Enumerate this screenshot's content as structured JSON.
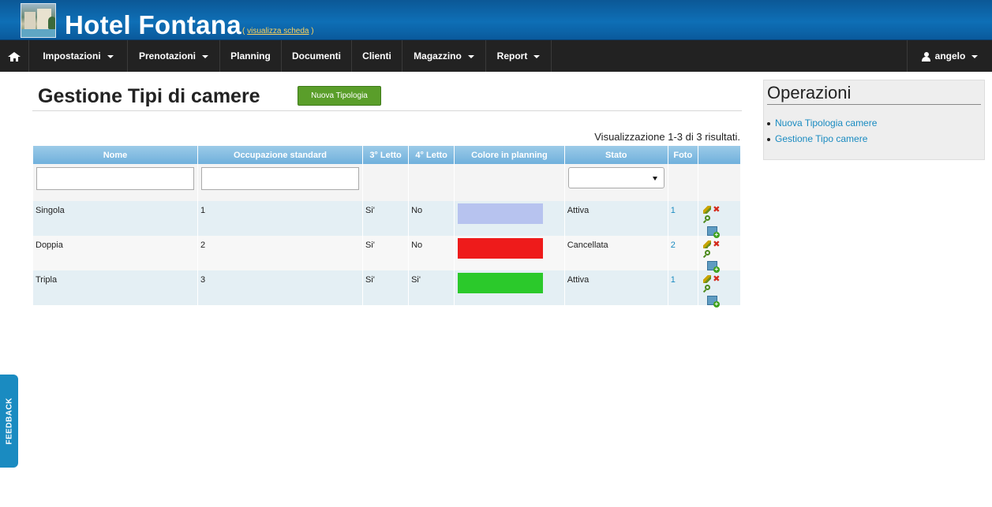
{
  "header": {
    "title": "Hotel Fontana",
    "link_open": "( ",
    "link_text": "visualizza scheda",
    "link_close": " )"
  },
  "nav": {
    "items": [
      {
        "label": "Impostazioni",
        "dropdown": true
      },
      {
        "label": "Prenotazioni",
        "dropdown": true
      },
      {
        "label": "Planning",
        "dropdown": false
      },
      {
        "label": "Documenti",
        "dropdown": false
      },
      {
        "label": "Clienti",
        "dropdown": false
      },
      {
        "label": "Magazzino",
        "dropdown": true
      },
      {
        "label": "Report",
        "dropdown": true
      }
    ],
    "user": "angelo"
  },
  "main": {
    "title": "Gestione Tipi di camere",
    "new_button": "Nuova Tipologia",
    "summary": "Visualizzazione 1-3 di 3 risultati."
  },
  "table": {
    "columns": [
      "Nome",
      "Occupazione standard",
      "3° Letto",
      "4° Letto",
      "Colore in planning",
      "Stato",
      "Foto",
      ""
    ],
    "rows": [
      {
        "nome": "Singola",
        "occupazione": "1",
        "letto3": "Si'",
        "letto4": "No",
        "colore": "#b7c3ef",
        "stato": "Attiva",
        "foto": "1"
      },
      {
        "nome": "Doppia",
        "occupazione": "2",
        "letto3": "Si'",
        "letto4": "No",
        "colore": "#ee1b1b",
        "stato": "Cancellata",
        "foto": "2"
      },
      {
        "nome": "Tripla",
        "occupazione": "3",
        "letto3": "Si'",
        "letto4": "Si'",
        "colore": "#2bc92b",
        "stato": "Attiva",
        "foto": "1"
      }
    ]
  },
  "sidebar": {
    "title": "Operazioni",
    "links": [
      "Nuova Tipologia camere",
      "Gestione Tipo camere"
    ]
  },
  "feedback": "FEEDBACK",
  "icons": {
    "logo": "hotel-photo-logo",
    "home": "home-icon",
    "user": "user-icon",
    "edit": "pencil-icon",
    "delete": "delete-icon",
    "view": "magnifier-icon",
    "photo": "add-photo-icon"
  },
  "colors": {
    "header": "#0e6fb6",
    "navbar": "#222222",
    "button": "#5a9e2a",
    "link": "#1a8bc1"
  }
}
